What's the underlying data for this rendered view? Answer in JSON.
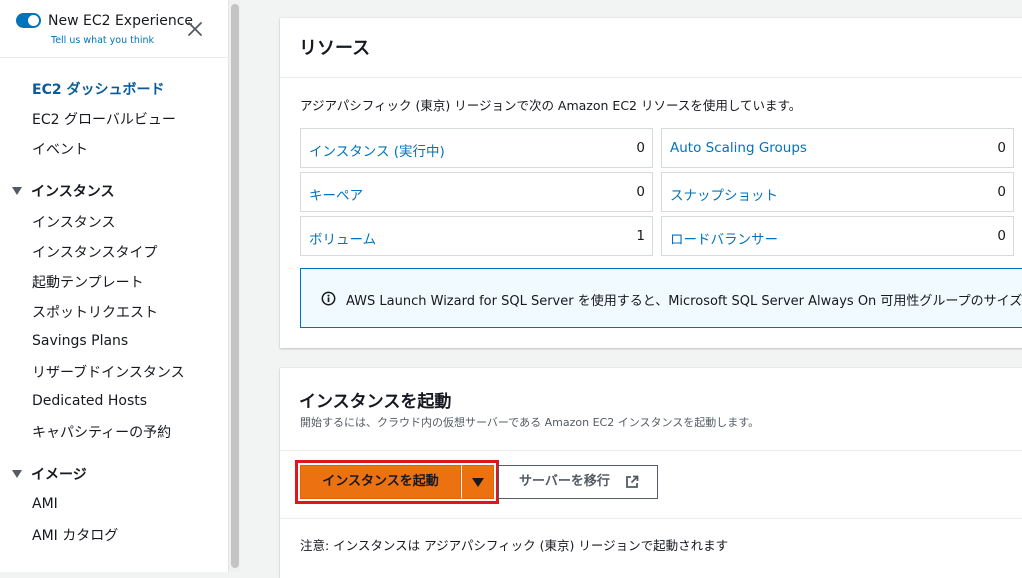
{
  "experience": {
    "title": "New EC2 Experience",
    "feedback_link": "Tell us what you think",
    "toggle_color": "#0073bb"
  },
  "sidebar": {
    "top_items": [
      {
        "label": "EC2 ダッシュボード",
        "active": true
      },
      {
        "label": "EC2 グローバルビュー"
      },
      {
        "label": "イベント"
      }
    ],
    "instances_section": {
      "title": "インスタンス",
      "items": [
        "インスタンス",
        "インスタンスタイプ",
        "起動テンプレート",
        "スポットリクエスト",
        "Savings Plans",
        "リザーブドインスタンス",
        "Dedicated Hosts",
        "キャパシティーの予約"
      ]
    },
    "images_section": {
      "title": "イメージ",
      "items": [
        "AMI",
        "AMI カタログ"
      ]
    }
  },
  "resources": {
    "title": "リソース",
    "description": "アジアパシフィック (東京) リージョンで次の Amazon EC2 リソースを使用しています。",
    "cells": [
      {
        "label": "インスタンス (実行中)",
        "count": "0"
      },
      {
        "label": "Auto Scaling Groups",
        "count": "0"
      },
      {
        "label": "キーペア",
        "count": "0"
      },
      {
        "label": "スナップショット",
        "count": "0"
      },
      {
        "label": "ボリューム",
        "count": "1"
      },
      {
        "label": "ロードバランサー",
        "count": "0"
      }
    ],
    "info_text": "AWS Launch Wizard for SQL Server を使用すると、Microsoft SQL Server Always On 可用性グループのサイズ"
  },
  "launch": {
    "title": "インスタンスを起動",
    "description": "開始するには、クラウド内の仮想サーバーである Amazon EC2 インスタンスを起動します。",
    "launch_button": "インスタンスを起動",
    "migrate_button": "サーバーを移行",
    "note": "注意: インスタンスは アジアパシフィック (東京) リージョンで起動されます"
  },
  "colors": {
    "primary": "#ec7211",
    "link": "#0073bb",
    "highlight": "#e3151c",
    "active_nav": "#0a5b97"
  }
}
